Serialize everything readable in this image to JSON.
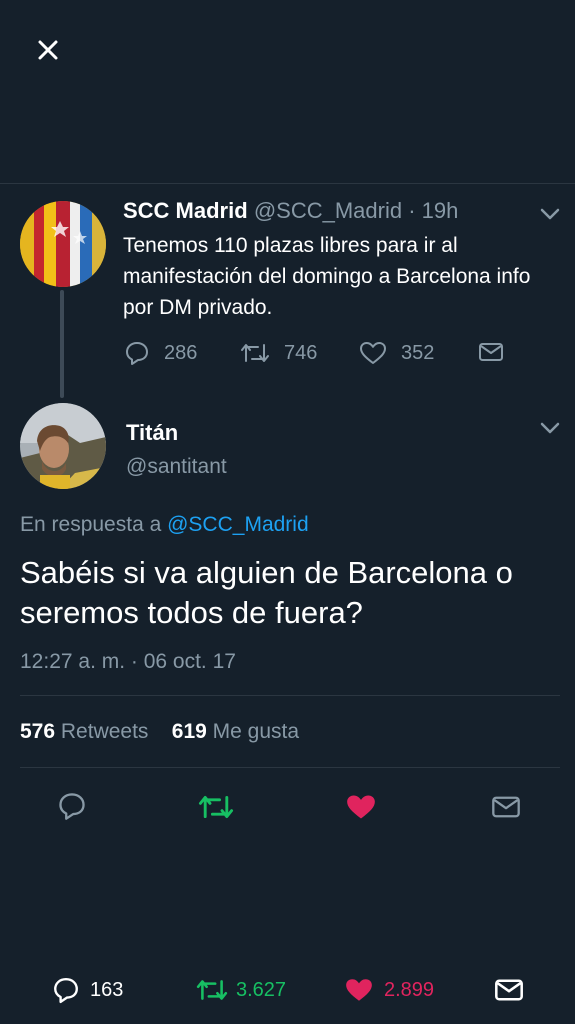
{
  "colors": {
    "background": "#15202b",
    "muted": "#8899a6",
    "link": "#1da1f2",
    "retweet": "#17bf63",
    "like": "#e0245e"
  },
  "header": {
    "close_icon": "close-icon"
  },
  "original_tweet": {
    "name": "SCC Madrid",
    "handle": "@SCC_Madrid",
    "separator": "·",
    "time": "19h",
    "text": "Tenemos 110 plazas libres para ir al manifestación del domingo a Barcelona info por DM privado.",
    "replies": "286",
    "retweets": "746",
    "likes": "352"
  },
  "reply_tweet": {
    "name": "Titán",
    "handle": "@santitant",
    "in_reply_prefix": "En respuesta a",
    "in_reply_handle": "@SCC_Madrid",
    "text": "Sabéis si va alguien de Barcelona o seremos todos de fuera?",
    "timestamp": "12:27 a. m. · 06 oct. 17",
    "retweet_count": "576",
    "retweet_label": "Retweets",
    "like_count": "619",
    "like_label": "Me gusta",
    "liked": true,
    "retweeted": true
  },
  "bottom_bar": {
    "replies": "163",
    "retweets": "3.627",
    "likes": "2.899"
  }
}
